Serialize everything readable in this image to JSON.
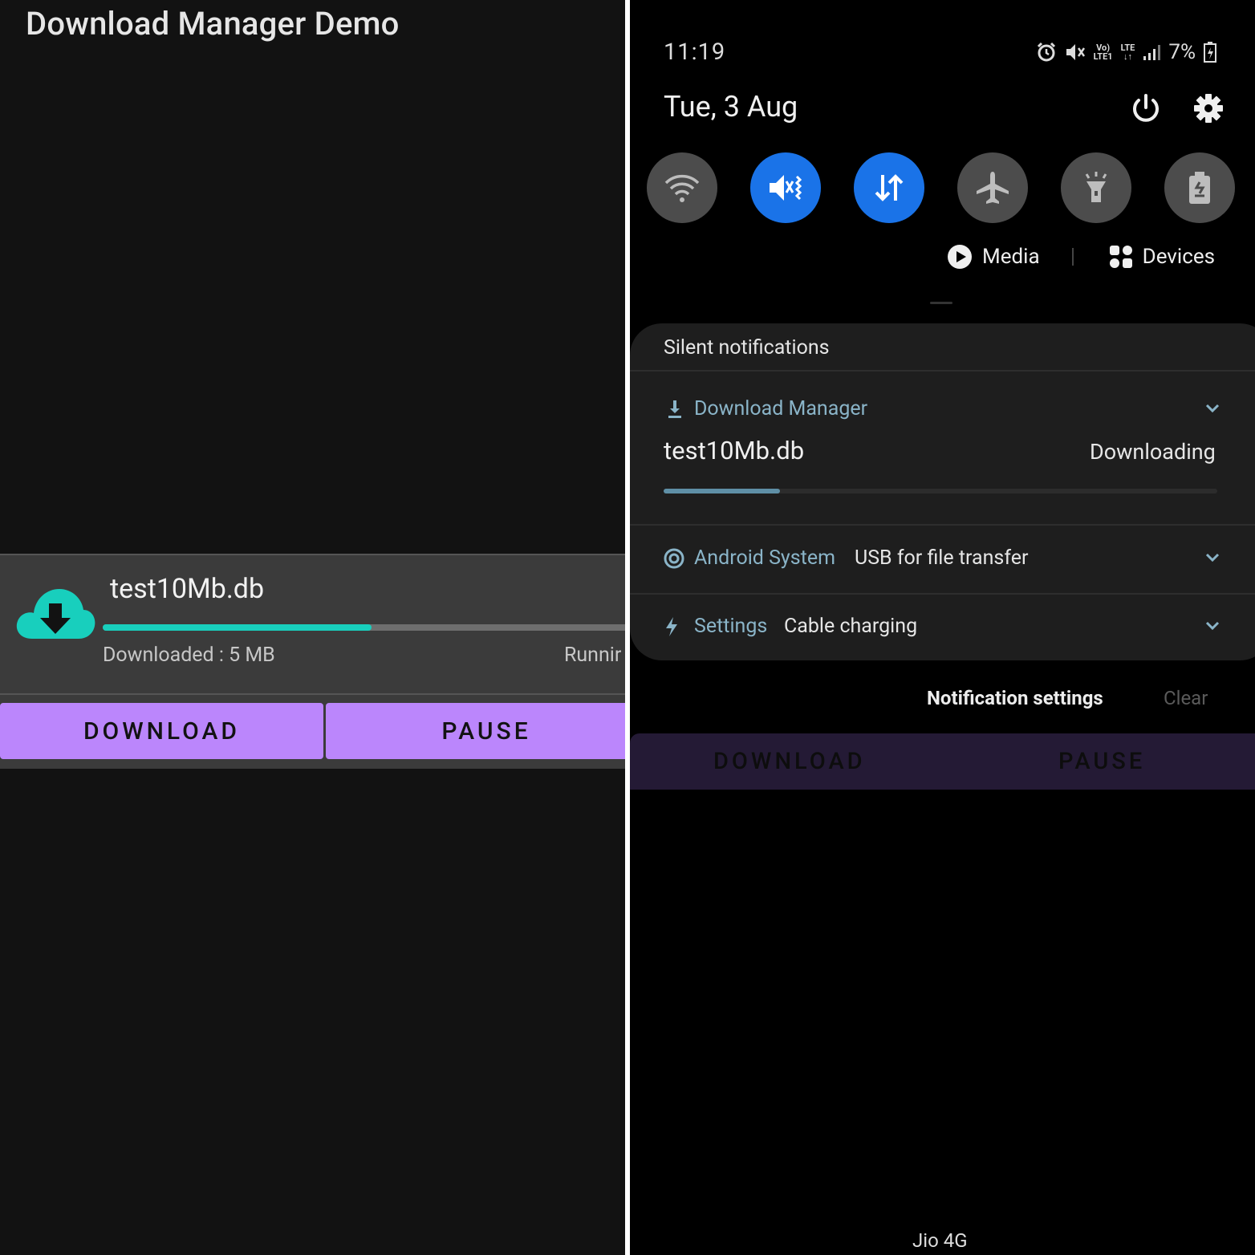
{
  "app": {
    "title": "Download Manager Demo",
    "download": {
      "file_name": "test10Mb.db",
      "progress": 0.5,
      "downloaded_text": "Downloaded : 5 MB",
      "status_text": "Runnir"
    },
    "buttons": {
      "download": "DOWNLOAD",
      "pause": "PAUSE"
    },
    "colors": {
      "accent": "#bb86fc",
      "progress": "#18cfbd",
      "icon": "#18cfbd"
    }
  },
  "shade": {
    "time": "11:19",
    "battery": "7%",
    "date": "Tue, 3 Aug",
    "status_icons": [
      "alarm-icon",
      "mute-icon",
      "volte-icon",
      "lte-icon",
      "signal-icon",
      "battery-icon"
    ],
    "volte_label_top": "Vo)",
    "volte_label_bottom": "LTE1",
    "lte_label": "LTE",
    "quick_settings": [
      {
        "name": "wifi",
        "active": false
      },
      {
        "name": "mute",
        "active": true
      },
      {
        "name": "mobile-data",
        "active": true
      },
      {
        "name": "airplane",
        "active": false
      },
      {
        "name": "flashlight",
        "active": false
      },
      {
        "name": "power-saving",
        "active": false
      }
    ],
    "media_label": "Media",
    "devices_label": "Devices",
    "silent_header": "Silent notifications",
    "notifications": {
      "download_manager": {
        "app": "Download Manager",
        "file": "test10Mb.db",
        "status": "Downloading",
        "progress": 0.21
      },
      "android_system": {
        "app": "Android System",
        "message": "USB for file transfer"
      },
      "settings": {
        "app": "Settings",
        "message": "Cable charging"
      }
    },
    "notification_settings": "Notification settings",
    "clear": "Clear",
    "background_buttons": {
      "download": "DOWNLOAD",
      "pause": "PAUSE"
    },
    "carrier": "Jio 4G",
    "colors": {
      "qs_active": "#1a73e8",
      "app_name": "#8ab4c8"
    }
  }
}
